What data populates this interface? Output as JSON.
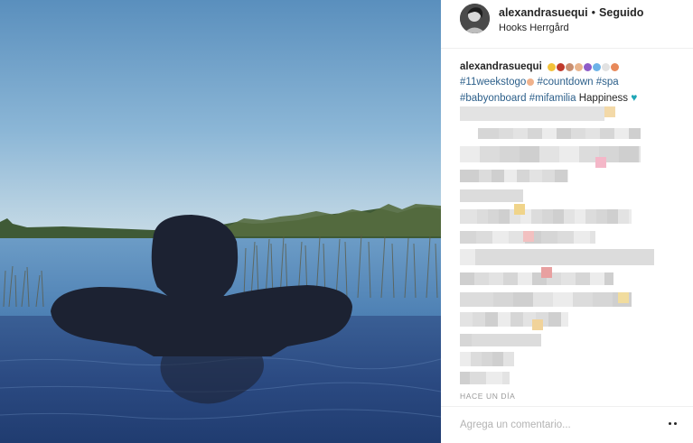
{
  "post": {
    "username": "alexandrasuequi",
    "separator": "•",
    "follow_status": "Seguido",
    "location": "Hooks Herrgård",
    "avatar_icon": "profile-avatar"
  },
  "caption": {
    "username": "alexandrasuequi",
    "emoji_colors": [
      "#f3c23a",
      "#c0392b",
      "#c98f70",
      "#e9b48c",
      "#8e5cc8",
      "#6db3e8",
      "#e2e2e2",
      "#e8895a"
    ],
    "tag1": "#11weekstogo",
    "tag2": "#countdown",
    "tag3": "#spa",
    "tag4": "#babyonboard",
    "tag5": "#mifamilia",
    "text_after": "Happiness",
    "heart_icon": "teal-heart-icon",
    "heart_color": "#1fa6b6"
  },
  "time_label": "HACE UN DÍA",
  "comment": {
    "placeholder": "Agrega un comentario...",
    "more_icon": "more-options-icon"
  },
  "colors": {
    "hashtag": "#2c5f8a",
    "muted": "#999999"
  }
}
